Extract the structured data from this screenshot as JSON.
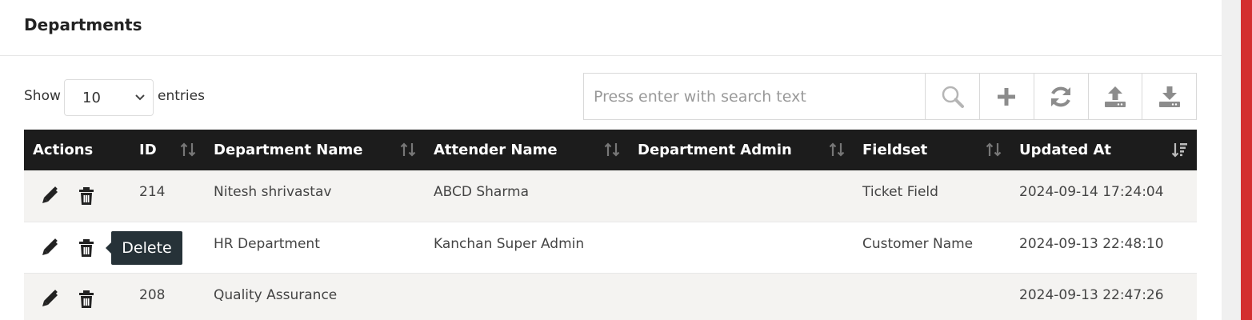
{
  "panel": {
    "title": "Departments"
  },
  "length_control": {
    "show_label": "Show",
    "selected": "10",
    "entries_label": "entries"
  },
  "search": {
    "placeholder": "Press enter with search text"
  },
  "toolbar_icons": [
    "search-icon",
    "plus-icon",
    "refresh-icon",
    "upload-icon",
    "download-icon"
  ],
  "table": {
    "headers": [
      "Actions",
      "ID",
      "Department Name",
      "Attender Name",
      "Department Admin",
      "Fieldset",
      "Updated At"
    ],
    "rows": [
      {
        "id": "214",
        "department_name": "Nitesh shrivastav",
        "attender_name": "ABCD Sharma",
        "department_admin": "",
        "fieldset": "Ticket Field",
        "updated_at": "2024-09-14 17:24:04"
      },
      {
        "id": "",
        "department_name": "HR Department",
        "attender_name": "Kanchan Super Admin",
        "department_admin": "",
        "fieldset": "Customer Name",
        "updated_at": "2024-09-13 22:48:10"
      },
      {
        "id": "208",
        "department_name": "Quality Assurance",
        "attender_name": "",
        "department_admin": "",
        "fieldset": "",
        "updated_at": "2024-09-13 22:47:26"
      }
    ]
  },
  "tooltip": {
    "text": "Delete"
  },
  "colors": {
    "header_bg": "#1c1c1c",
    "tooltip_bg": "#263238",
    "accent_strip": "#d32f2f",
    "row_alt": "#f4f3f1"
  }
}
